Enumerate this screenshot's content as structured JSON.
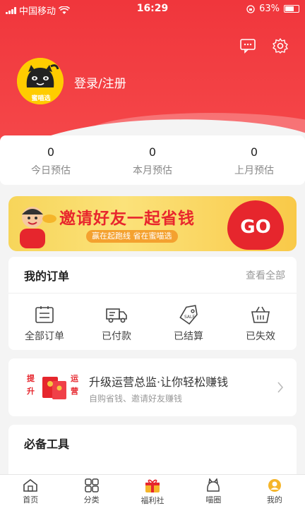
{
  "status_bar": {
    "carrier": "中国移动",
    "time": "16:29",
    "battery": "63%"
  },
  "header": {
    "login_label": "登录/注册",
    "avatar_text": "蜜喵选"
  },
  "stats": [
    {
      "value": "0",
      "label": "今日预估"
    },
    {
      "value": "0",
      "label": "本月预估"
    },
    {
      "value": "0",
      "label": "上月预估"
    }
  ],
  "banner": {
    "title": "邀请好友一起省钱",
    "subtitle": "赢在起跑线  省在蜜喵选",
    "go": "GO"
  },
  "orders": {
    "title": "我的订单",
    "view_all": "查看全部",
    "items": [
      {
        "label": "全部订单",
        "icon": "order-list-icon"
      },
      {
        "label": "已付款",
        "icon": "truck-icon"
      },
      {
        "label": "已结算",
        "icon": "sale-tag-icon"
      },
      {
        "label": "已失效",
        "icon": "basket-icon"
      }
    ]
  },
  "promo": {
    "title": "升级运营总监·让你轻松赚钱",
    "subtitle": "自购省钱、邀请好友赚钱",
    "badge_left": "提升",
    "badge_right": "运营"
  },
  "tools": {
    "title": "必备工具"
  },
  "tabbar": [
    {
      "label": "首页",
      "icon": "home-icon"
    },
    {
      "label": "分类",
      "icon": "grid-icon"
    },
    {
      "label": "福利社",
      "icon": "gift-icon"
    },
    {
      "label": "喵圈",
      "icon": "cat-icon"
    },
    {
      "label": "我的",
      "icon": "profile-icon"
    }
  ],
  "colors": {
    "brand_red": "#f0363c",
    "banner_yellow": "#f7d55a"
  }
}
